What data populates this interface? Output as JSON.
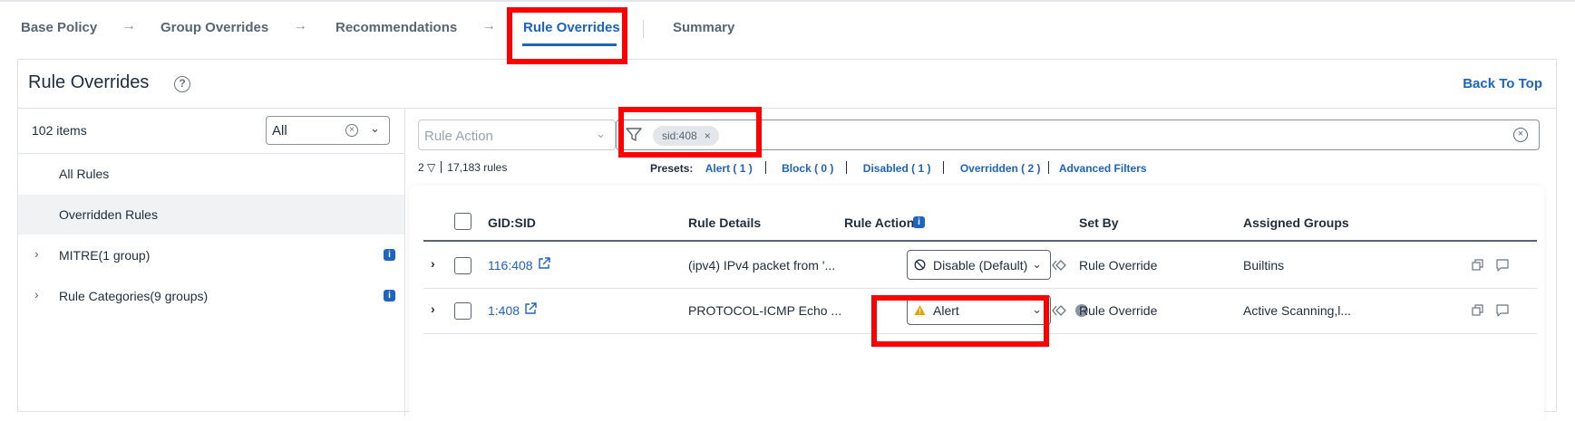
{
  "steps": [
    {
      "label": "Base Policy"
    },
    {
      "label": "Group Overrides"
    },
    {
      "label": "Recommendations"
    },
    {
      "label": "Rule Overrides"
    },
    {
      "label": "Summary"
    }
  ],
  "step_arrow": "→",
  "panel": {
    "title": "Rule Overrides",
    "help_icon": "?",
    "back_to_top": "Back To Top"
  },
  "sidebar": {
    "items_count": "102 items",
    "filter_value": "All",
    "items": [
      {
        "label": "All Rules"
      },
      {
        "label": "Overridden Rules"
      },
      {
        "label": "MITRE(1 group)"
      },
      {
        "label": "Rule Categories(9 groups)"
      }
    ]
  },
  "filters": {
    "rule_action_placeholder": "Rule Action",
    "chip": "sid:408",
    "filter_count": "2",
    "rules_total": "17,183 rules"
  },
  "presets": {
    "label": "Presets:",
    "links": [
      "Alert ( 1 )",
      "Block ( 0 )",
      "Disabled ( 1 )",
      "Overridden ( 2 )",
      "Advanced Filters"
    ]
  },
  "table": {
    "columns": [
      "GID:SID",
      "Rule Details",
      "Rule Action",
      "Set By",
      "Assigned Groups"
    ],
    "rows": [
      {
        "gid_sid": "116:408",
        "details": "(ipv4) IPv4 packet from '...",
        "action": "Disable (Default)",
        "set_by": "Rule Override",
        "groups": "Builtins"
      },
      {
        "gid_sid": "1:408",
        "details": "PROTOCOL-ICMP Echo ...",
        "action": "Alert",
        "set_by": "Rule Override",
        "groups": "Active Scanning,l..."
      }
    ]
  },
  "colors": {
    "accent": "#1d64c0",
    "highlight": "#ff0000",
    "alert_warning": "#e8a200"
  },
  "icons": [
    "help-icon",
    "clear-icon",
    "chevron-down-icon",
    "chevron-right-icon",
    "info-icon",
    "filter-icon",
    "external-link-icon",
    "disable-icon",
    "warning-icon",
    "diamond-icon",
    "check-icon",
    "copy-icon",
    "comment-icon"
  ]
}
